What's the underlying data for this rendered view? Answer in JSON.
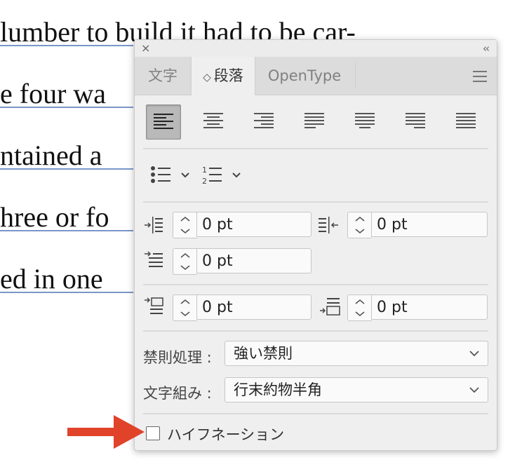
{
  "document": {
    "lines": [
      "lumber to build it had to be car-",
      "e four wa",
      "ntained a",
      "hree or fo",
      "ed in one"
    ]
  },
  "panel": {
    "close_glyph": "×",
    "collapse_glyph": "‹‹",
    "tabs": [
      {
        "label": "文字"
      },
      {
        "label": "段落"
      },
      {
        "label": "OpenType"
      }
    ],
    "active_tab_indicator": "◇",
    "alignment_buttons": [
      "align-left",
      "align-center",
      "align-right",
      "justify-last-left",
      "justify-last-center",
      "justify-last-right",
      "justify-all"
    ],
    "selected_alignment": "align-left",
    "indents": {
      "left_indent": "0 pt",
      "right_indent": "0 pt",
      "first_line_indent": "0 pt",
      "space_before": "0 pt",
      "space_after": "0 pt"
    },
    "kinsoku_label": "禁則処理 :",
    "kinsoku_value": "強い禁則",
    "mojikumi_label": "文字組み :",
    "mojikumi_value": "行末約物半角",
    "hyphenation_label": "ハイフネーション",
    "hyphenation_checked": false
  },
  "colors": {
    "annotation_arrow": "#e0432a",
    "underline": "#7b96c9"
  }
}
